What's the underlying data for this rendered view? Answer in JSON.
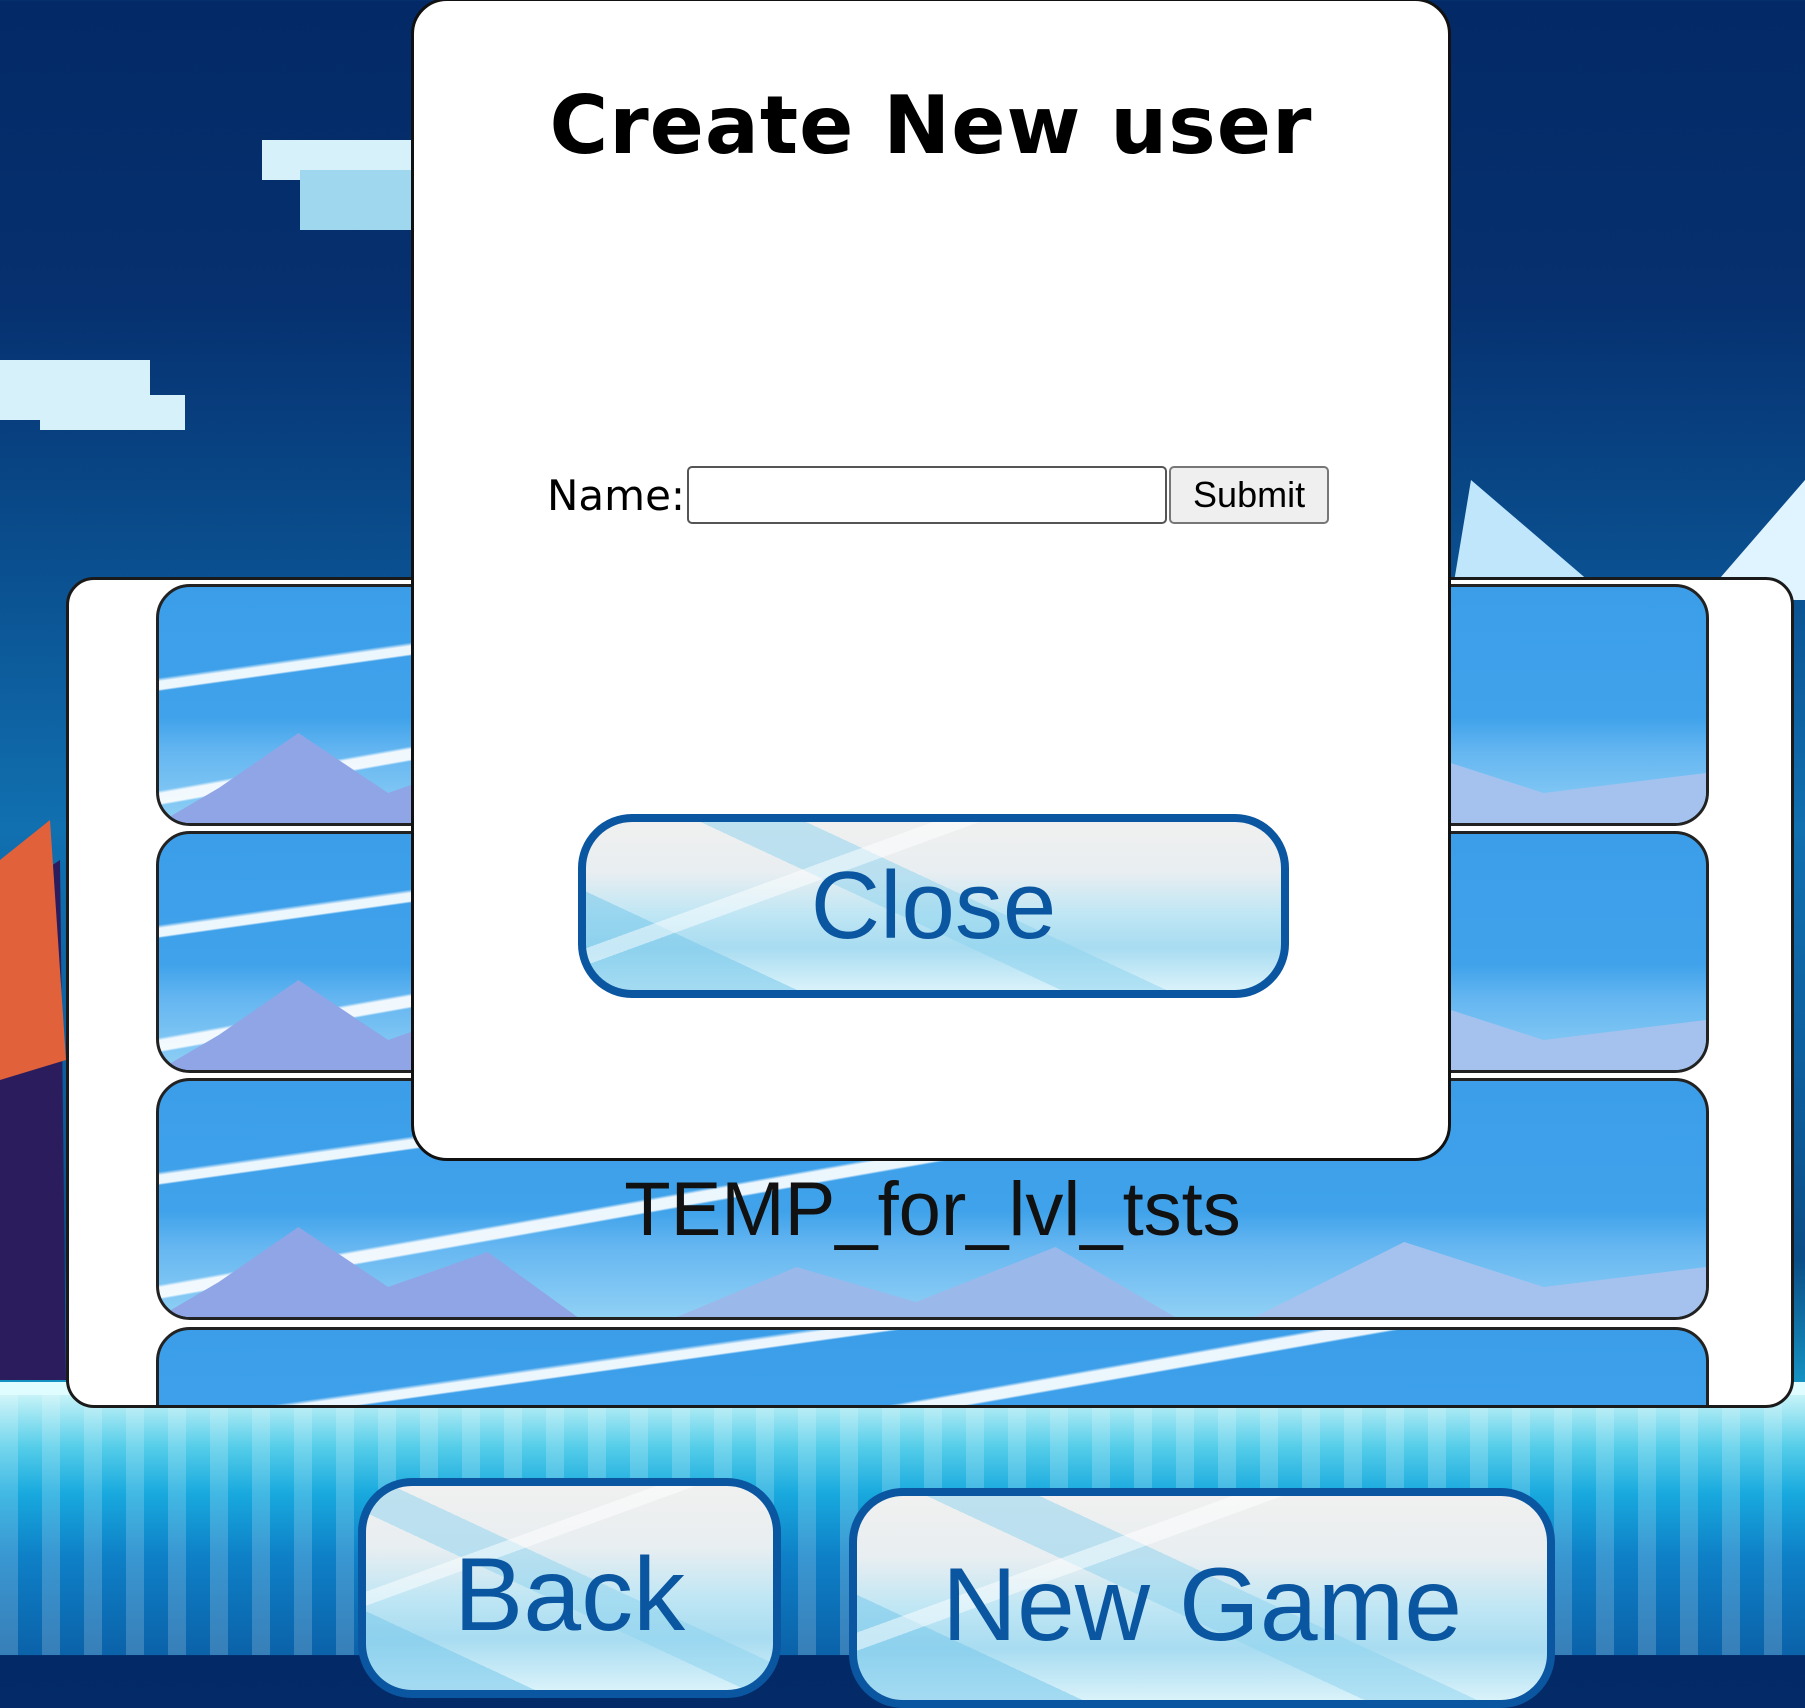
{
  "modal": {
    "title": "Create New user",
    "name_label": "Name:",
    "name_value": "",
    "submit_label": "Submit",
    "close_label": "Close"
  },
  "save_slots": [
    {
      "label": ""
    },
    {
      "label": ""
    },
    {
      "label": "TEMP_for_lvl_tsts"
    },
    {
      "label": ""
    }
  ],
  "footer": {
    "back_label": "Back",
    "new_game_label": "New Game"
  },
  "colors": {
    "button_text": "#0b56a0",
    "button_border": "#0b56a0",
    "sky_top": "#032a66"
  }
}
